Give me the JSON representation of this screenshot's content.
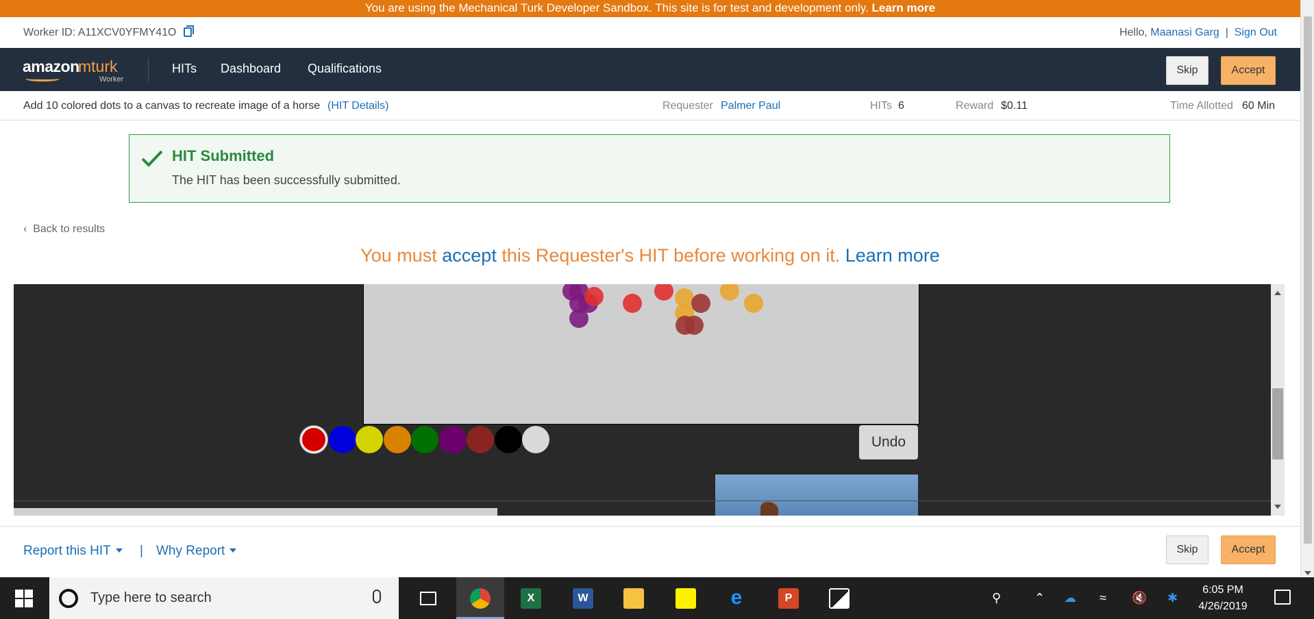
{
  "banner": {
    "text": "You are using the Mechanical Turk Developer Sandbox. This site is for test and development only.",
    "link": "Learn more"
  },
  "worker": {
    "id_label": "Worker ID: A11XCV0YFMY41O",
    "hello": "Hello,",
    "name": "Maanasi Garg",
    "sep": "|",
    "sign_out": "Sign Out"
  },
  "nav": {
    "logo_amazon": "amazon",
    "logo_mturk": "mturk",
    "logo_worker": "Worker",
    "items": [
      "HITs",
      "Dashboard",
      "Qualifications"
    ],
    "skip": "Skip",
    "accept": "Accept"
  },
  "hit": {
    "title": "Add 10 colored dots to a canvas to recreate image of a horse",
    "details": "(HIT Details)",
    "requester_label": "Requester",
    "requester": "Palmer Paul",
    "hits_label": "HITs",
    "hits": "6",
    "reward_label": "Reward",
    "reward": "$0.11",
    "time_label": "Time Allotted",
    "time": "60 Min"
  },
  "alert": {
    "title": "HIT Submitted",
    "text": "The HIT has been successfully submitted."
  },
  "back": "Back to results",
  "must_accept": {
    "pre": "You must",
    "accept": "accept",
    "mid": "this Requester's HIT before working on it.",
    "learn": "Learn more"
  },
  "task": {
    "undo": "Undo",
    "palette": [
      "#d40000",
      "#0000dd",
      "#d4d400",
      "#d98200",
      "#007000",
      "#6e006e",
      "#8b2323",
      "#000000",
      "#d9d9d9"
    ],
    "canvas_dots": [
      {
        "c": "#7d1b7e"
      },
      {
        "c": "#7d1b7e"
      },
      {
        "c": "#7d1b7e"
      },
      {
        "c": "#7d1b7e"
      },
      {
        "c": "#7d1b7e"
      },
      {
        "c": "#e03030"
      },
      {
        "c": "#e03030"
      },
      {
        "c": "#e03030"
      },
      {
        "c": "#e8a630"
      },
      {
        "c": "#e8a630"
      },
      {
        "c": "#e8a630"
      },
      {
        "c": "#e8a630"
      },
      {
        "c": "#9b3535"
      },
      {
        "c": "#9b3535"
      },
      {
        "c": "#9b3535"
      }
    ]
  },
  "footer": {
    "report": "Report this HIT",
    "sep": "|",
    "why": "Why Report",
    "skip": "Skip",
    "accept": "Accept"
  },
  "taskbar": {
    "search_placeholder": "Type here to search",
    "time": "6:05 PM",
    "date": "4/26/2019"
  }
}
